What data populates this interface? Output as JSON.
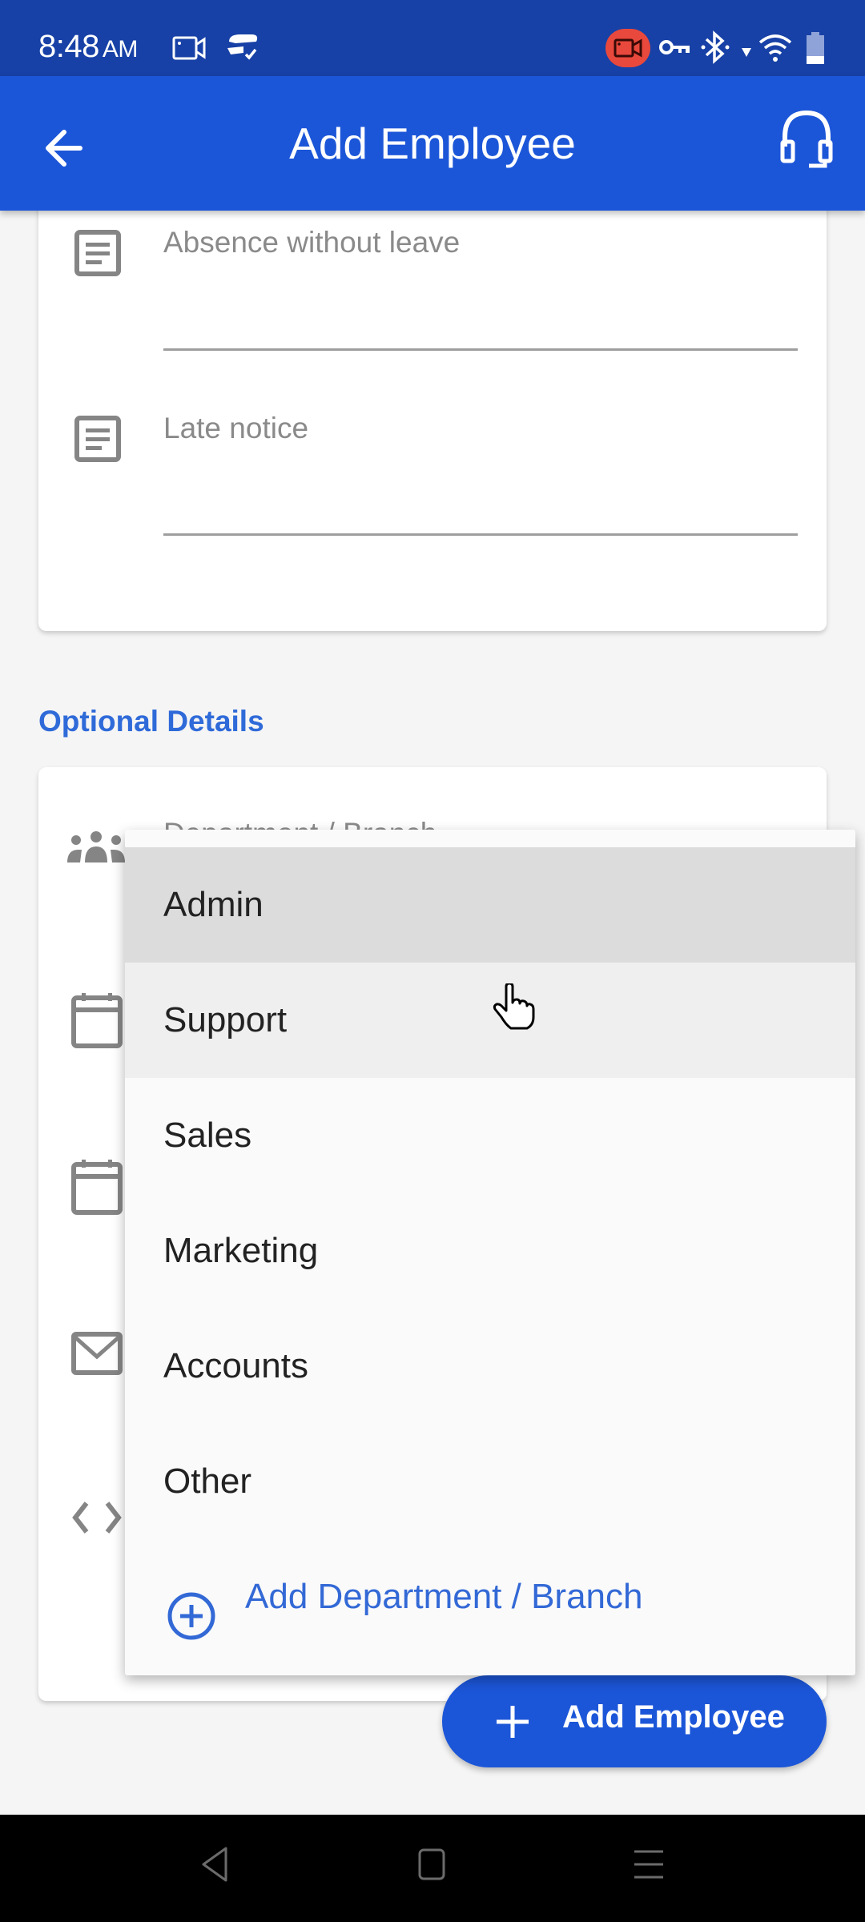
{
  "status_bar": {
    "time": "8:48",
    "ampm": "AM",
    "icons": [
      "screen-record-icon",
      "sync-check-icon",
      "recording-indicator-icon",
      "vpn-key-icon",
      "bluetooth-icon",
      "data-arrow-icon",
      "wifi-icon",
      "battery-icon"
    ],
    "battery_level_percent": 25,
    "recording_color": "#e9483c"
  },
  "app_bar": {
    "title": "Add Employee",
    "back_icon": "arrow-left-icon",
    "support_icon": "headset-icon",
    "color": "#1c56d8"
  },
  "leave_card": {
    "fields": [
      {
        "label": "Absence without leave",
        "icon": "notes-icon",
        "value": ""
      },
      {
        "label": "Late notice",
        "icon": "notes-icon",
        "value": ""
      }
    ]
  },
  "optional_details": {
    "section_title": "Optional Details",
    "fields": [
      {
        "label": "Department / Branch",
        "icon": "group-icon"
      },
      {
        "label": "",
        "icon": "calendar-icon"
      },
      {
        "label": "",
        "icon": "calendar-icon"
      },
      {
        "label": "",
        "icon": "mail-icon"
      },
      {
        "label": "",
        "icon": "code-icon"
      }
    ]
  },
  "department_menu": {
    "items": [
      {
        "label": "Admin",
        "state": "selected"
      },
      {
        "label": "Support",
        "state": "hover"
      },
      {
        "label": "Sales",
        "state": ""
      },
      {
        "label": "Marketing",
        "state": ""
      },
      {
        "label": "Accounts",
        "state": ""
      },
      {
        "label": "Other",
        "state": ""
      }
    ],
    "add_label": "Add Department / Branch",
    "accent": "#3369d6"
  },
  "fab": {
    "label": "Add Employee"
  },
  "nav_bar": {
    "buttons": [
      "back",
      "home",
      "recents"
    ]
  }
}
